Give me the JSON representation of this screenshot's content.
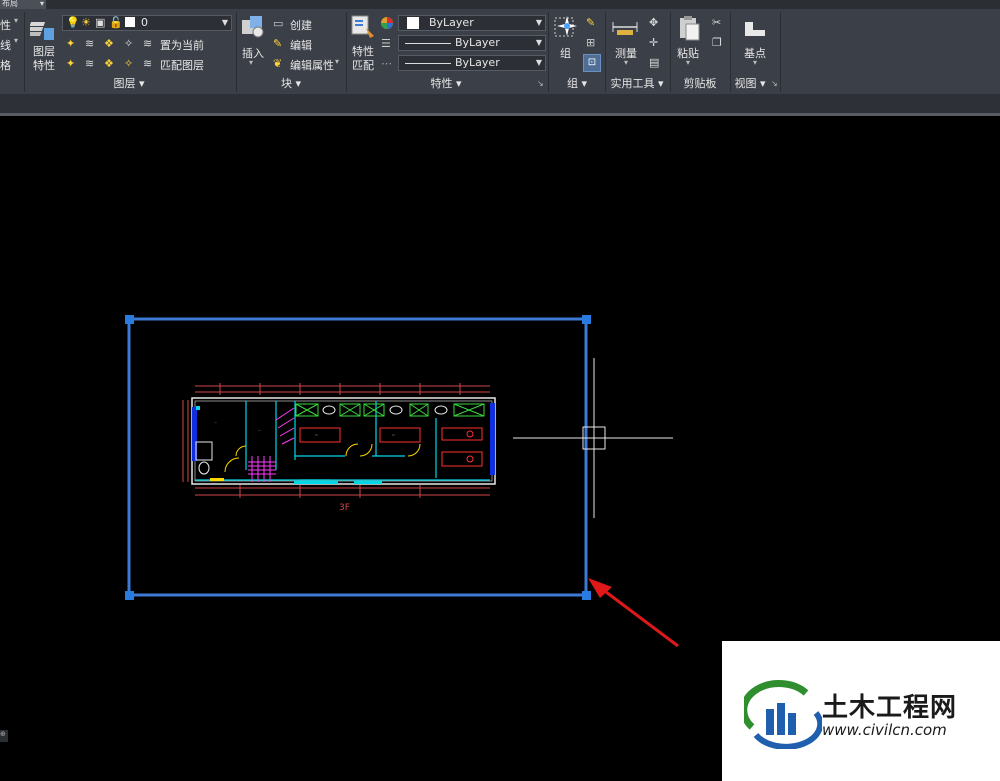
{
  "tabs": {
    "active": "布局",
    "extra": "▾"
  },
  "left_panel": {
    "items": [
      "性",
      "线",
      "格"
    ]
  },
  "layer_panel": {
    "title": "图层",
    "button": "图层\n特性",
    "current_layer": "0",
    "set_current": "置为当前",
    "match_layer": "匹配图层"
  },
  "block_panel": {
    "title": "块",
    "insert": "插入",
    "create": "创建",
    "edit": "编辑",
    "edit_attr": "编辑属性"
  },
  "properties_panel": {
    "title": "特性",
    "match": "特性\n匹配",
    "color": "ByLayer",
    "linetype": "ByLayer",
    "lineweight": "ByLayer"
  },
  "group_panel": {
    "title": "组",
    "group": "组"
  },
  "utilities_panel": {
    "title": "实用工具",
    "measure": "测量"
  },
  "clipboard_panel": {
    "title": "剪贴板",
    "paste": "粘贴"
  },
  "view_panel": {
    "title": "视图",
    "base": "基点"
  },
  "drawing": {
    "floor_label": "3F"
  },
  "watermark": {
    "brand": "土木工程网",
    "url": "www.civilcn.com"
  },
  "colors": {
    "selection": "#3d7ad6",
    "cyan": "#00d8e8",
    "magenta": "#ff3cff",
    "arrow": "#e01818",
    "watermark_green": "#2f8f2f",
    "watermark_blue": "#1f5fae"
  }
}
